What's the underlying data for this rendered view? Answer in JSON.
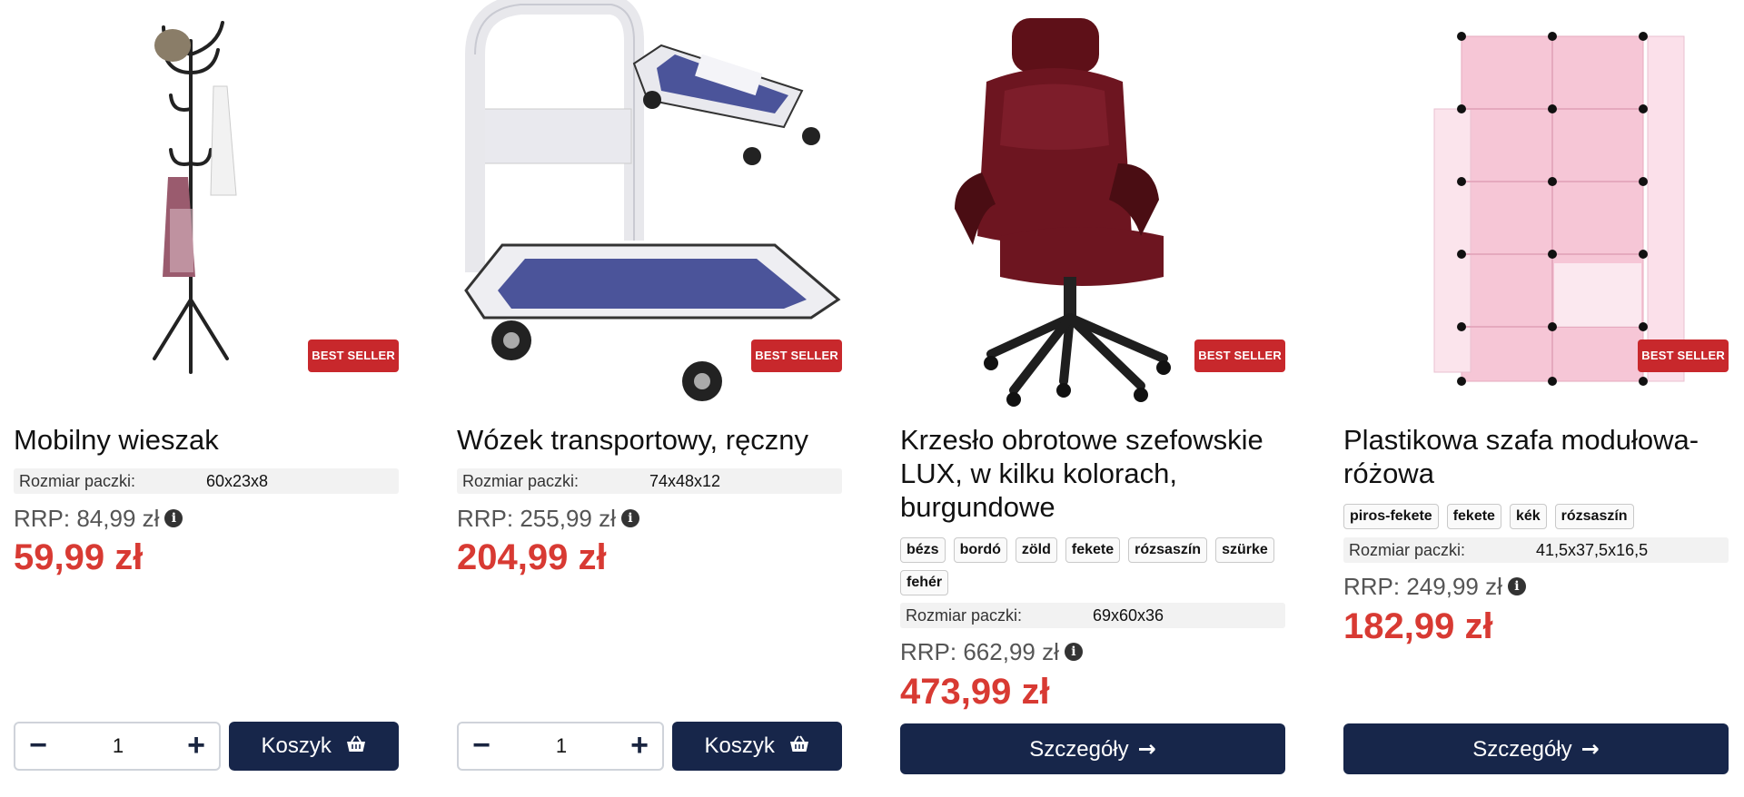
{
  "badge_label": "BEST SELLER",
  "package_label": "Rozmiar paczki:",
  "rrp_prefix": "RRP:",
  "colors": {
    "accent_red": "#d83a33",
    "badge_red": "#c8282c",
    "button_navy": "#17264a"
  },
  "products": [
    {
      "title": "Mobilny wieszak",
      "package_size": "60x23x8",
      "rrp": "RRP: 84,99 zł",
      "price": "59,99 zł",
      "quantity": "1",
      "cart_label": "Koszyk",
      "image_icon": "coat-rack-image"
    },
    {
      "title": "Wózek transportowy, ręczny",
      "package_size": "74x48x12",
      "rrp": "RRP: 255,99 zł",
      "price": "204,99 zł",
      "quantity": "1",
      "cart_label": "Koszyk",
      "image_icon": "hand-truck-image"
    },
    {
      "title": "Krzesło obrotowe szefowskie LUX, w kilku kolorach, burgundowe",
      "tags": [
        "bézs",
        "bordó",
        "zöld",
        "fekete",
        "rózsaszín",
        "szürke",
        "fehér"
      ],
      "package_size": "69x60x36",
      "rrp": "RRP: 662,99 zł",
      "price": "473,99 zł",
      "details_label": "Szczegóły",
      "image_icon": "office-chair-image"
    },
    {
      "title": "Plastikowa szafa modułowa- różowa",
      "tags": [
        "piros-fekete",
        "fekete",
        "kék",
        "rózsaszín"
      ],
      "package_size": "41,5x37,5x16,5",
      "rrp": "RRP: 249,99 zł",
      "price": "182,99 zł",
      "details_label": "Szczegóły",
      "image_icon": "modular-wardrobe-image"
    }
  ]
}
